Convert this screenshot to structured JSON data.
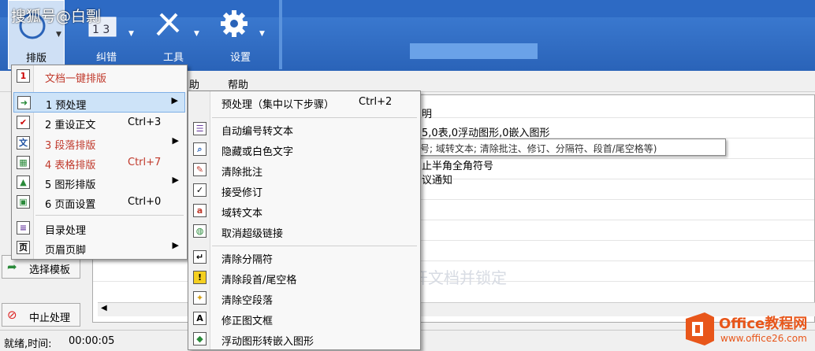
{
  "watermark": "搜狐号@白剽",
  "ribbon": {
    "buttons": [
      {
        "label": "排版"
      },
      {
        "label": "纠错"
      },
      {
        "label": "工具"
      },
      {
        "label": "设置"
      }
    ]
  },
  "menubar": {
    "items": [
      "助",
      "帮助"
    ]
  },
  "content": {
    "lines": [
      "明",
      "5,0表,0浮动图形,0嵌入图形",
      "止半角全角符号",
      "议通知"
    ],
    "watermark_text": "开文档并锁定"
  },
  "tooltip": "编号; 域转文本; 清除批注、修订、分隔符、段首/尾空格等)",
  "sidebar": {
    "template_btn": "选择模板",
    "stop_btn": "中止处理"
  },
  "status": {
    "text": "就绪,时间:",
    "time": "00:00:05"
  },
  "main_menu": {
    "items": [
      {
        "label": "文档一键排版",
        "shortcut": "",
        "icon": "1"
      },
      {
        "label": "1 预处理",
        "shortcut": "",
        "icon": "➜"
      },
      {
        "label": "2 重设正文",
        "shortcut": "Ctrl+3",
        "icon": "✔"
      },
      {
        "label": "3 段落排版",
        "shortcut": "",
        "icon": "文"
      },
      {
        "label": "4 表格排版",
        "shortcut": "Ctrl+7",
        "icon": "▦"
      },
      {
        "label": "5 图形排版",
        "shortcut": "",
        "icon": "▲"
      },
      {
        "label": "6 页面设置",
        "shortcut": "Ctrl+0",
        "icon": "▣"
      },
      {
        "label": "目录处理",
        "shortcut": "",
        "icon": "≡"
      },
      {
        "label": "页眉页脚",
        "shortcut": "",
        "icon": "页"
      }
    ]
  },
  "sub_menu": {
    "items": [
      {
        "label": "预处理（集中以下步骤）",
        "shortcut": "Ctrl+2"
      },
      {
        "label": "自动编号转文本"
      },
      {
        "label": "隐藏或白色文字"
      },
      {
        "label": "清除批注"
      },
      {
        "label": "接受修订"
      },
      {
        "label": "域转文本"
      },
      {
        "label": "取消超级链接"
      },
      {
        "label": "清除分隔符"
      },
      {
        "label": "清除段首/尾空格"
      },
      {
        "label": "清除空段落"
      },
      {
        "label": "修正图文框"
      },
      {
        "label": "浮动图形转嵌入图形"
      }
    ]
  },
  "logo": {
    "brand": "Office教程网",
    "url": "www.office26.com"
  },
  "colors": {
    "ribbon": "#2a63b8",
    "highlight": "#cde3f8",
    "accent_red": "#c0392b",
    "logo_orange": "#e8561a"
  }
}
